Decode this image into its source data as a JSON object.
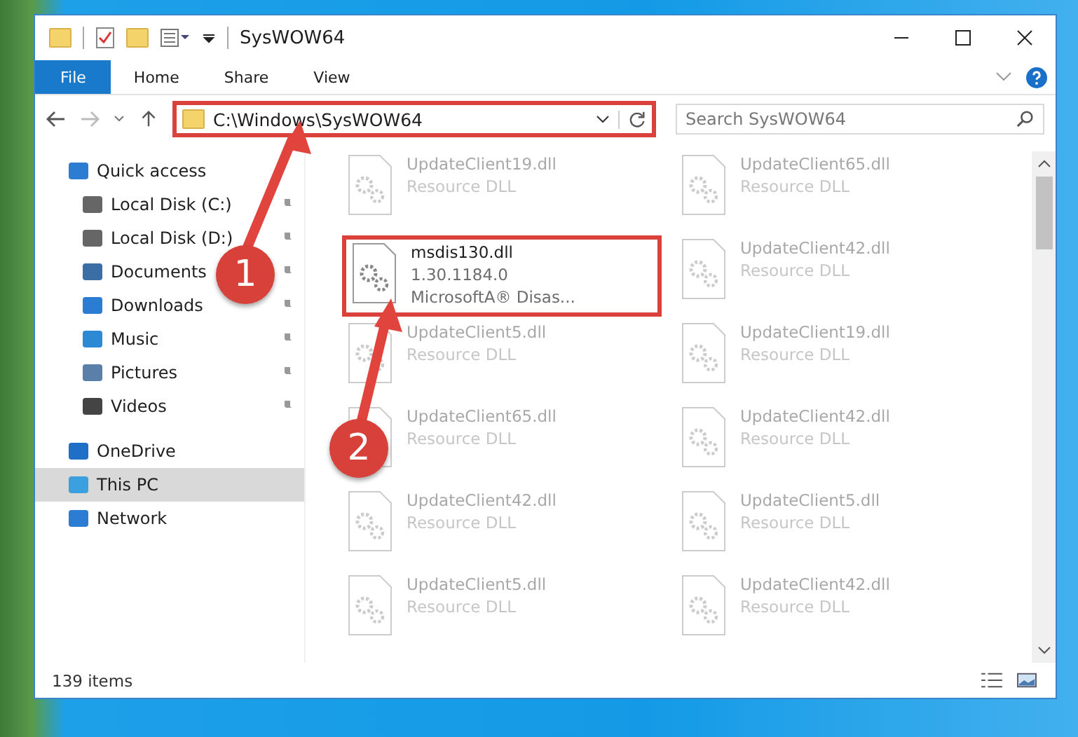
{
  "window": {
    "title": "SysWOW64"
  },
  "ribbon_tabs": [
    {
      "label": "File",
      "kind": "file",
      "selected": false
    },
    {
      "label": "Home",
      "kind": "tab",
      "selected": false
    },
    {
      "label": "Share",
      "kind": "tab",
      "selected": false
    },
    {
      "label": "View",
      "kind": "tab",
      "selected": false
    }
  ],
  "address_bar": {
    "path": "C:\\Windows\\SysWOW64",
    "highlighted": true
  },
  "search": {
    "placeholder": "Search SysWOW64"
  },
  "sidebar": {
    "items": [
      {
        "label": "Quick access",
        "selected": false,
        "children": [
          {
            "label": "Local Disk (C:)",
            "pinned": true
          },
          {
            "label": "Local Disk (D:)",
            "pinned": true
          },
          {
            "label": "Documents",
            "pinned": true
          },
          {
            "label": "Downloads",
            "pinned": true
          },
          {
            "label": "Music",
            "pinned": true
          },
          {
            "label": "Pictures",
            "pinned": true
          },
          {
            "label": "Videos",
            "pinned": true
          }
        ]
      },
      {
        "label": "OneDrive",
        "selected": false
      },
      {
        "label": "This PC",
        "selected": true
      },
      {
        "label": "Network",
        "selected": false
      }
    ]
  },
  "files": [
    {
      "name": "UpdateClient19.dll",
      "details": [
        "Resource DLL"
      ],
      "dimmed": true,
      "highlighted": false
    },
    {
      "name": "UpdateClient65.dll",
      "details": [
        "Resource DLL"
      ],
      "dimmed": true,
      "highlighted": false
    },
    {
      "name": "msdis130.dll",
      "details": [
        "1.30.1184.0",
        "MicrosoftA® Disas..."
      ],
      "dimmed": false,
      "highlighted": true
    },
    {
      "name": "UpdateClient42.dll",
      "details": [
        "Resource DLL"
      ],
      "dimmed": true,
      "highlighted": false
    },
    {
      "name": "UpdateClient5.dll",
      "details": [
        "Resource DLL"
      ],
      "dimmed": true,
      "highlighted": false
    },
    {
      "name": "UpdateClient19.dll",
      "details": [
        "Resource DLL"
      ],
      "dimmed": true,
      "highlighted": false
    },
    {
      "name": "UpdateClient65.dll",
      "details": [
        "Resource DLL"
      ],
      "dimmed": true,
      "highlighted": false
    },
    {
      "name": "UpdateClient42.dll",
      "details": [
        "Resource DLL"
      ],
      "dimmed": true,
      "highlighted": false
    },
    {
      "name": "UpdateClient42.dll",
      "details": [
        "Resource DLL"
      ],
      "dimmed": true,
      "highlighted": false
    },
    {
      "name": "UpdateClient5.dll",
      "details": [
        "Resource DLL"
      ],
      "dimmed": true,
      "highlighted": false
    },
    {
      "name": "UpdateClient5.dll",
      "details": [
        "Resource DLL"
      ],
      "dimmed": true,
      "highlighted": false
    },
    {
      "name": "UpdateClient42.dll",
      "details": [
        "Resource DLL"
      ],
      "dimmed": true,
      "highlighted": false
    }
  ],
  "status_bar": {
    "item_count": "139 items"
  },
  "annotations": [
    {
      "number": "1"
    },
    {
      "number": "2"
    }
  ]
}
